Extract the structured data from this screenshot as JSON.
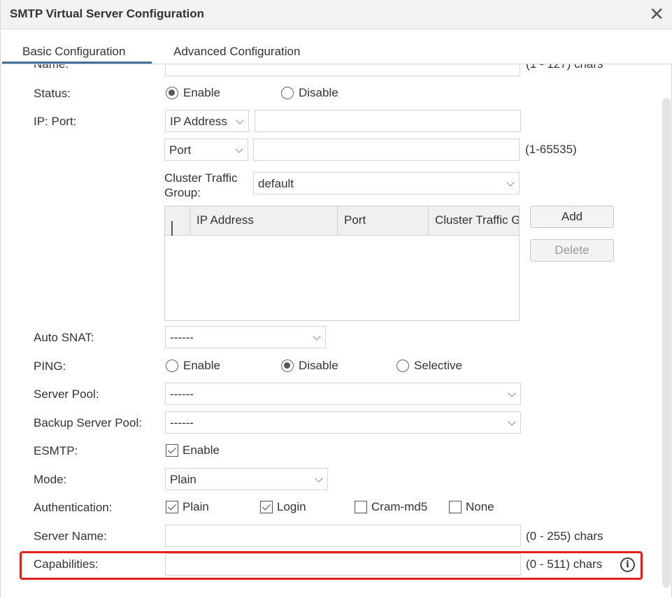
{
  "window": {
    "title": "SMTP Virtual Server Configuration",
    "close_icon": "close-icon"
  },
  "tabs": [
    {
      "label": "Basic Configuration",
      "active": true
    },
    {
      "label": "Advanced Configuration",
      "active": false
    }
  ],
  "form": {
    "name": {
      "label": "Name:",
      "value": "",
      "hint": "(1 - 127) chars"
    },
    "status": {
      "label": "Status:",
      "options": [
        "Enable",
        "Disable"
      ],
      "selected": "Enable"
    },
    "ip_port": {
      "label": "IP: Port:",
      "address_type": "IP Address",
      "address_value": "",
      "port_type": "Port",
      "port_value": "",
      "port_hint": "(1-65535)",
      "cluster_label": "Cluster Traffic Group:",
      "cluster_value": "default",
      "table_headers": [
        "IP Address",
        "Port",
        "Cluster Traffic Group"
      ],
      "rows": [],
      "add_label": "Add",
      "delete_label": "Delete"
    },
    "auto_snat": {
      "label": "Auto SNAT:",
      "value": "------"
    },
    "ping": {
      "label": "PING:",
      "options": [
        "Enable",
        "Disable",
        "Selective"
      ],
      "selected": "Disable"
    },
    "server_pool": {
      "label": "Server Pool:",
      "value": "------"
    },
    "backup_pool": {
      "label": "Backup Server Pool:",
      "value": "------"
    },
    "esmtp": {
      "label": "ESMTP:",
      "option": "Enable",
      "checked": true
    },
    "mode": {
      "label": "Mode:",
      "value": "Plain"
    },
    "authentication": {
      "label": "Authentication:",
      "options": [
        {
          "label": "Plain",
          "checked": true
        },
        {
          "label": "Login",
          "checked": true
        },
        {
          "label": "Cram-md5",
          "checked": false
        },
        {
          "label": "None",
          "checked": false
        }
      ]
    },
    "server_name": {
      "label": "Server Name:",
      "value": "",
      "hint": "(0 - 255) chars"
    },
    "capabilities": {
      "label": "Capabilities:",
      "value": "",
      "hint": "(0 - 511) chars",
      "info_icon": "info-icon"
    }
  },
  "colors": {
    "highlight": "#e3201b",
    "tab_underline": "#3f6e96"
  }
}
